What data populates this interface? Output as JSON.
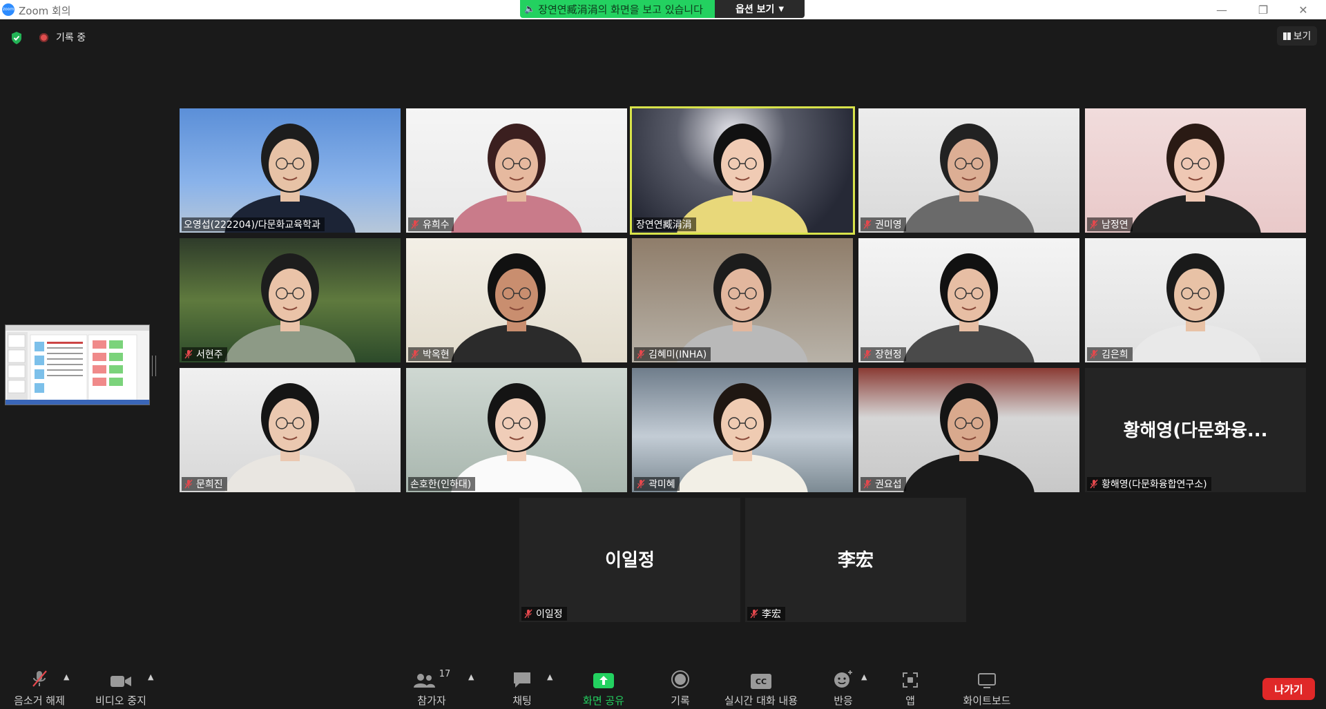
{
  "window": {
    "title": "Zoom 회의",
    "logo_text": "zoom"
  },
  "share_banner": {
    "text": "장연연臧涓涓의 화면을 보고 있습니다",
    "options_label": "옵션 보기"
  },
  "status": {
    "recording_label": "기록 중"
  },
  "view_button": {
    "label": "보기"
  },
  "participants": [
    {
      "name": "오영섭(222204)/다문화교육학과",
      "muted": false
    },
    {
      "name": "유희수",
      "muted": true
    },
    {
      "name": "장연연臧涓涓",
      "muted": false,
      "active_speaker": true
    },
    {
      "name": "권미영",
      "muted": true
    },
    {
      "name": "남정연",
      "muted": true
    },
    {
      "name": "서현주",
      "muted": true
    },
    {
      "name": "박옥현",
      "muted": true
    },
    {
      "name": "김혜미(INHA)",
      "muted": true
    },
    {
      "name": "장현정",
      "muted": true
    },
    {
      "name": "김은희",
      "muted": true
    },
    {
      "name": "문희진",
      "muted": true
    },
    {
      "name": "손호한(인하대)",
      "muted": false
    },
    {
      "name": "곽미혜",
      "muted": true
    },
    {
      "name": "권요섭",
      "muted": true
    },
    {
      "name": "황해영(다문화융합연구소)",
      "display_name": "황해영(다문화융...",
      "muted": true,
      "video_off": true
    },
    {
      "name": "이일정",
      "display_name": "이일정",
      "muted": true,
      "video_off": true
    },
    {
      "name": "李宏",
      "display_name": "李宏",
      "muted": true,
      "video_off": true
    }
  ],
  "toolbar": {
    "audio_label": "음소거 해제",
    "video_label": "비디오 중지",
    "participants_label": "참가자",
    "participants_count": "17",
    "chat_label": "채팅",
    "share_label": "화면 공유",
    "record_label": "기록",
    "captions_label": "실시간 대화 내용",
    "captions_badge": "CC",
    "reactions_label": "반응",
    "apps_label": "앱",
    "whiteboard_label": "화이트보드",
    "leave_label": "나가기"
  },
  "colors": {
    "leave": "#e02828",
    "share": "#23d160",
    "active_outline": "#d8e34a",
    "muted_icon": "#e5484d"
  }
}
